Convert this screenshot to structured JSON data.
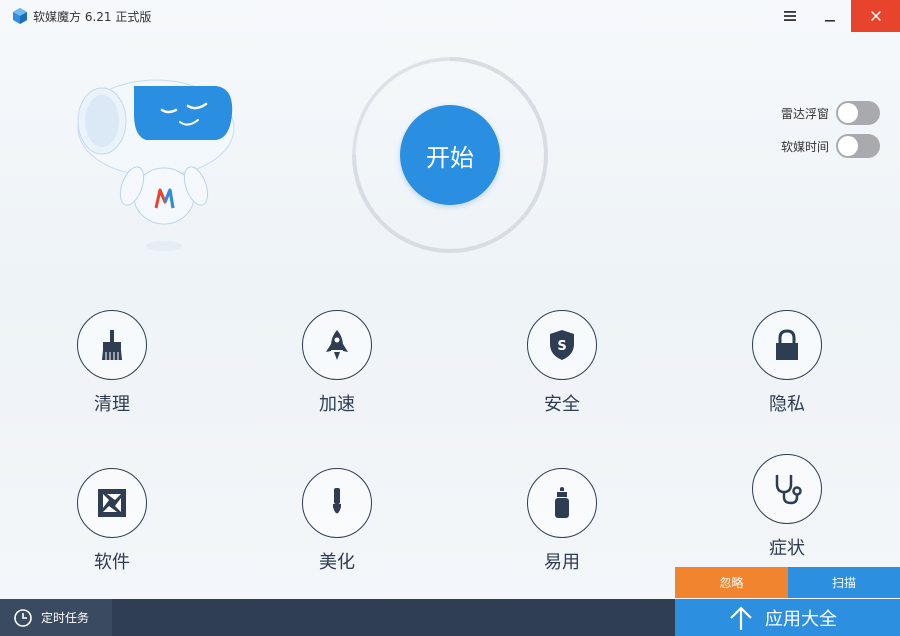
{
  "window": {
    "title": "软媒魔方 6.21 正式版"
  },
  "start": {
    "label": "开始"
  },
  "toggles": [
    {
      "label": "雷达浮窗",
      "on": false
    },
    {
      "label": "软媒时间",
      "on": false
    }
  ],
  "tiles": [
    {
      "label": "清理",
      "icon": "brush-icon"
    },
    {
      "label": "加速",
      "icon": "rocket-icon"
    },
    {
      "label": "安全",
      "icon": "shield-icon"
    },
    {
      "label": "隐私",
      "icon": "lock-icon"
    },
    {
      "label": "软件",
      "icon": "aperture-icon"
    },
    {
      "label": "美化",
      "icon": "paintbrush-icon"
    },
    {
      "label": "易用",
      "icon": "bottle-icon"
    },
    {
      "label": "症状",
      "icon": "stethoscope-icon"
    }
  ],
  "actions": {
    "ignore": "忽略",
    "scan": "扫描"
  },
  "footer": {
    "timer_task": "定时任务",
    "app_store": "应用大全"
  },
  "colors": {
    "accent_blue": "#2c8fe0",
    "orange": "#f1852f",
    "close_red": "#e8442d",
    "footer_dark": "#2f3e52",
    "icon_dark": "#2e3d52"
  }
}
